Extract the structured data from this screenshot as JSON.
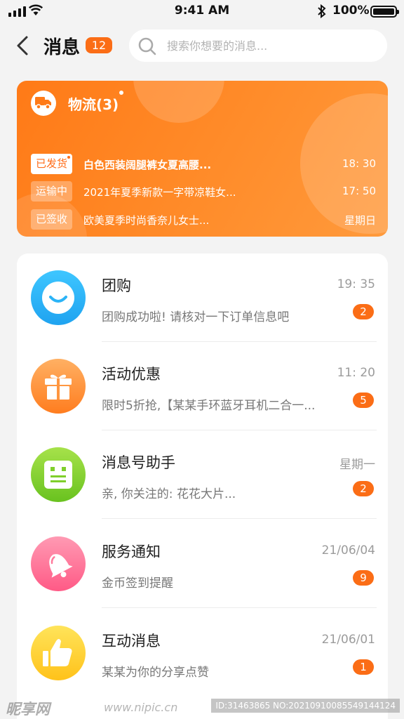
{
  "status_bar": {
    "time": "9:41 AM",
    "battery": "100%"
  },
  "nav": {
    "title": "消息",
    "badge": "12",
    "search_placeholder": "搜索你想要的消息..."
  },
  "logistics": {
    "title": "物流(3)",
    "rows": [
      {
        "tag": "已发货",
        "text": "白色西装阔腿裤女夏高腰...",
        "time": "18: 30"
      },
      {
        "tag": "运输中",
        "text": "2021年夏季新款一字带凉鞋女...",
        "time": "17: 50"
      },
      {
        "tag": "已签收",
        "text": "欧美夏季时尚香奈儿女士...",
        "time": "星期日"
      }
    ]
  },
  "messages": [
    {
      "name": "团购",
      "time": "19: 35",
      "preview": "团购成功啦! 请核对一下订单信息吧",
      "badge": "2",
      "icon": "smile-icon"
    },
    {
      "name": "活动优惠",
      "time": "11: 20",
      "preview": "限时5折抢,【某某手环蓝牙耳机二合一...",
      "badge": "5",
      "icon": "gift-icon"
    },
    {
      "name": "消息号助手",
      "time": "星期一",
      "preview": "亲, 你关注的: 花花大片...",
      "badge": "2",
      "icon": "robot-icon"
    },
    {
      "name": "服务通知",
      "time": "21/06/04",
      "preview": "金币签到提醒",
      "badge": "9",
      "icon": "bell-icon"
    },
    {
      "name": "互动消息",
      "time": "21/06/01",
      "preview": "某某为你的分享点赞",
      "badge": "1",
      "icon": "thumbs-up-icon"
    }
  ],
  "watermark": {
    "brand": "昵享网",
    "site": "www.nipic.cn",
    "id": "ID:31463865 NO:20210910085549144124"
  },
  "colors": {
    "accent": "#fb6d16",
    "logistics_gradient": [
      "#ff7a17",
      "#ff9a3c"
    ],
    "smile_gradient": [
      "#3ec6ff",
      "#1fa3f0"
    ],
    "gift_gradient": [
      "#ffb063",
      "#ff7d1f"
    ],
    "robot_gradient": [
      "#a6e24a",
      "#69c21f"
    ],
    "bell_gradient": [
      "#ff9ab3",
      "#ff5a86"
    ],
    "thumbs_gradient": [
      "#ffe45a",
      "#ffc21a"
    ]
  }
}
